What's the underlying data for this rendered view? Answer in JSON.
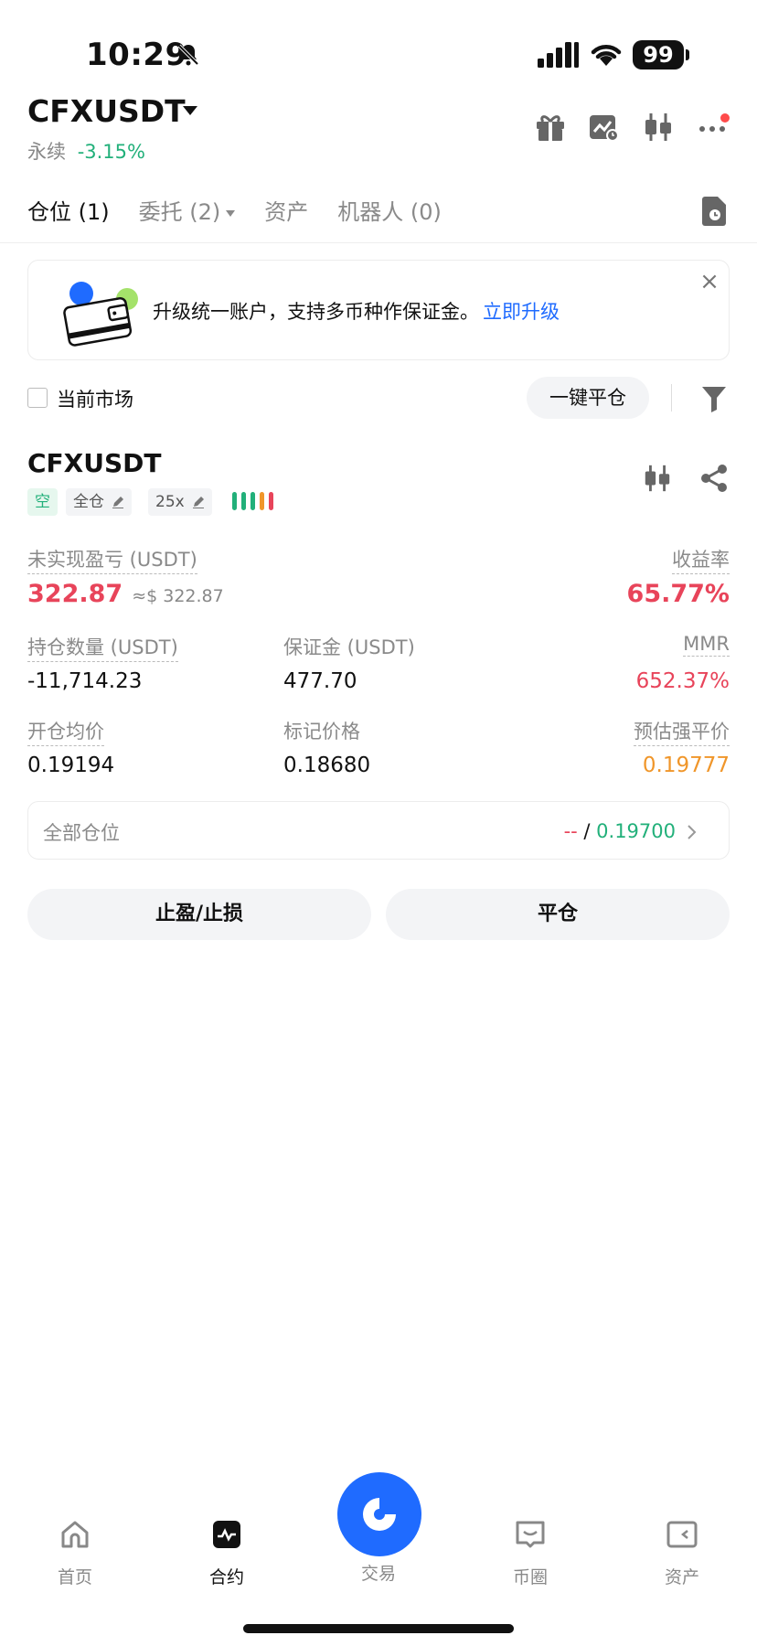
{
  "status_bar": {
    "time": "10:29",
    "battery": "99"
  },
  "header": {
    "symbol": "CFXUSDT",
    "kind": "永续",
    "change": "-3.15%"
  },
  "tabs": [
    {
      "label": "仓位 (1)",
      "active": true
    },
    {
      "label": "委托 (2)",
      "active": false
    },
    {
      "label": "资产",
      "active": false
    },
    {
      "label": "机器人 (0)",
      "active": false
    }
  ],
  "banner": {
    "text": "升级统一账户，支持多币种作保证金。",
    "link": "立即升级",
    "close": "×"
  },
  "filters": {
    "current_market_label": "当前市场",
    "close_all_label": "一键平仓"
  },
  "position": {
    "symbol": "CFXUSDT",
    "side": "空",
    "margin_mode": "全仓",
    "leverage": "25x",
    "unrealized_pnl_label": "未实现盈亏 (USDT)",
    "unrealized_pnl": "322.87",
    "unrealized_pnl_usd": "≈$ 322.87",
    "roe_label": "收益率",
    "roe": "65.77%",
    "size_label": "持仓数量 (USDT)",
    "size": "-11,714.23",
    "margin_label": "保证金 (USDT)",
    "margin": "477.70",
    "mmr_label": "MMR",
    "mmr": "652.37%",
    "entry_label": "开仓均价",
    "entry": "0.19194",
    "mark_label": "标记价格",
    "mark": "0.18680",
    "liq_label": "预估强平价",
    "liq": "0.19777",
    "all_positions_label": "全部仓位",
    "all_positions_tp": "--",
    "all_positions_sep": " / ",
    "all_positions_sl": "0.19700",
    "tpsl_button": "止盈/止损",
    "close_button": "平仓"
  },
  "bottom_nav": [
    {
      "label": "首页",
      "icon": "home-icon"
    },
    {
      "label": "合约",
      "icon": "futures-icon"
    },
    {
      "label": "交易",
      "icon": "trade-icon"
    },
    {
      "label": "币圈",
      "icon": "community-icon"
    },
    {
      "label": "资产",
      "icon": "wallet-icon"
    }
  ],
  "colors": {
    "up": "#22b07a",
    "down": "#e8445a",
    "accent": "#1f6bff",
    "warning": "#f0962a"
  }
}
